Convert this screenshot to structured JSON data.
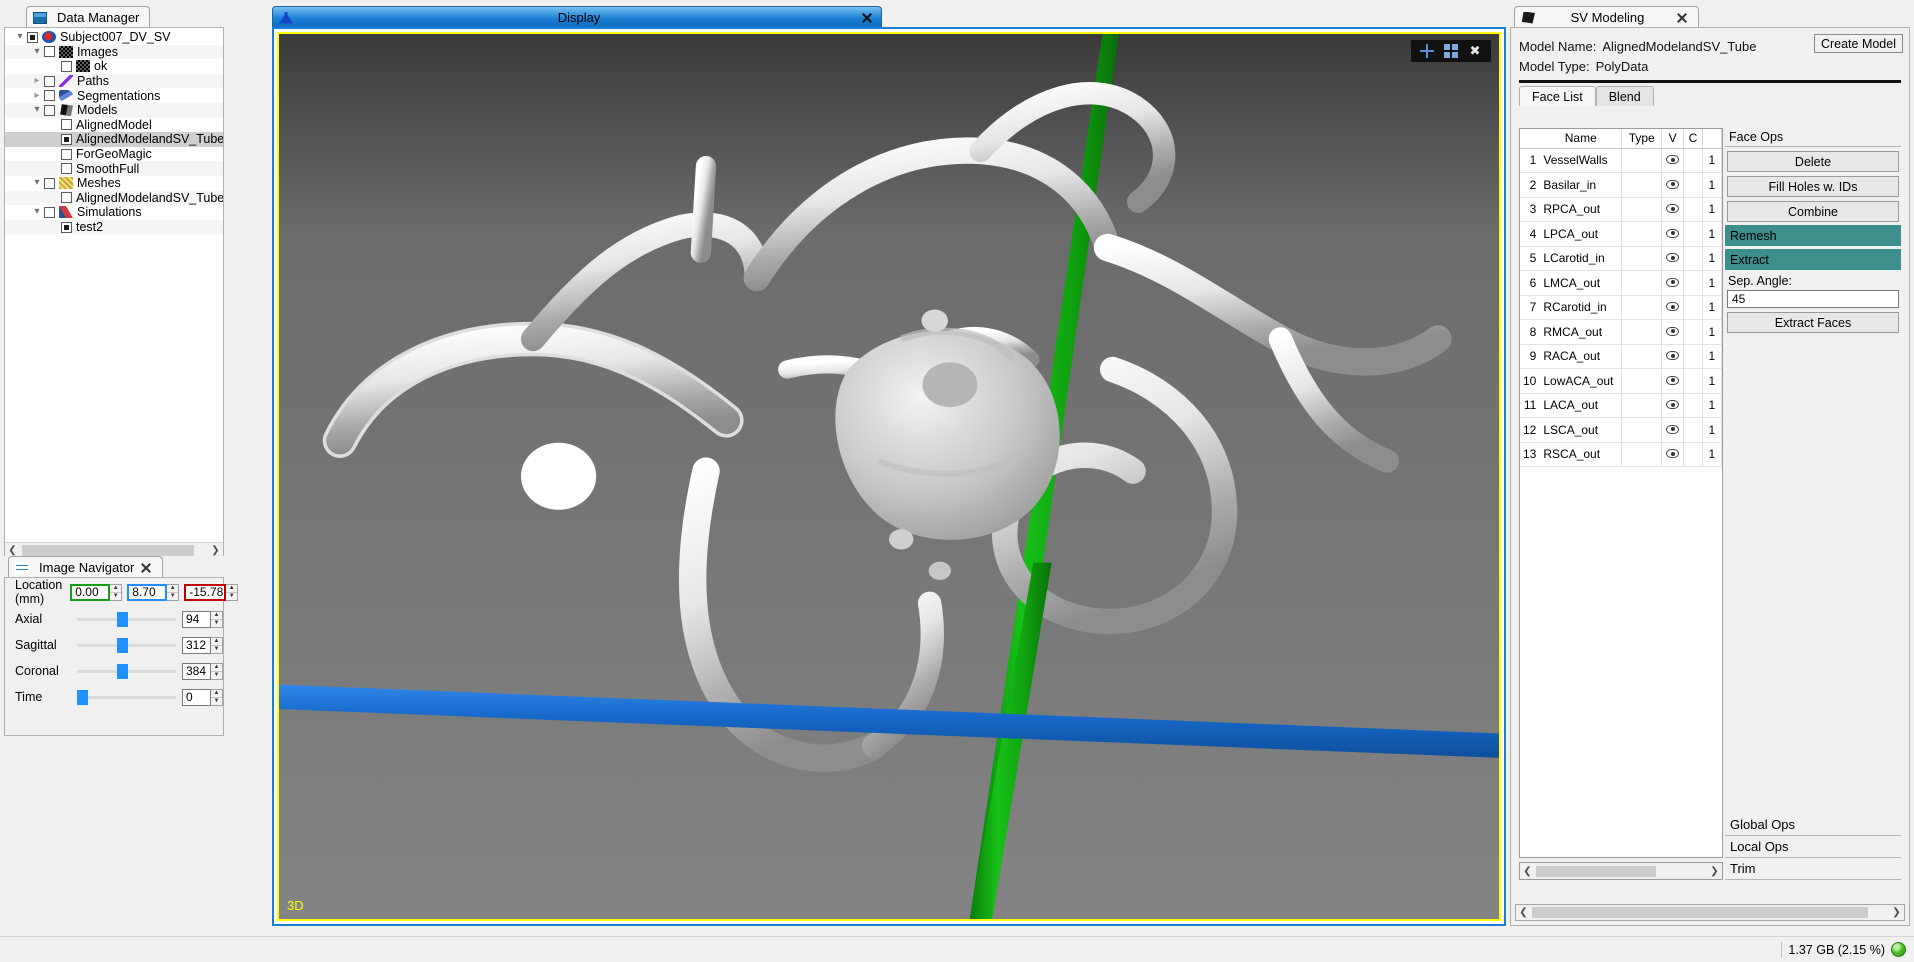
{
  "data_manager": {
    "tab_label": "Data Manager",
    "tab_icon": "data-manager-icon",
    "tree": [
      {
        "label": "Subject007_DV_SV",
        "indent": 0,
        "arrow": "down",
        "checkbox": "filled",
        "icon": "project-icon"
      },
      {
        "label": "Images",
        "indent": 1,
        "arrow": "down",
        "checkbox": "empty",
        "icon": "image-icon"
      },
      {
        "label": "ok",
        "indent": 2,
        "arrow": "none",
        "checkbox": "empty",
        "icon": "image-icon"
      },
      {
        "label": "Paths",
        "indent": 1,
        "arrow": "right",
        "checkbox": "empty",
        "icon": "path-icon"
      },
      {
        "label": "Segmentations",
        "indent": 1,
        "arrow": "right",
        "checkbox": "empty",
        "icon": "segmentation-icon"
      },
      {
        "label": "Models",
        "indent": 1,
        "arrow": "down",
        "checkbox": "empty",
        "icon": "model-icon"
      },
      {
        "label": "AlignedModel",
        "indent": 2,
        "arrow": "none",
        "checkbox": "empty",
        "icon": "none"
      },
      {
        "label": "AlignedModelandSV_Tube",
        "indent": 2,
        "arrow": "none",
        "checkbox": "filled",
        "icon": "none",
        "selected": true
      },
      {
        "label": "ForGeoMagic",
        "indent": 2,
        "arrow": "none",
        "checkbox": "empty",
        "icon": "none"
      },
      {
        "label": "SmoothFull",
        "indent": 2,
        "arrow": "none",
        "checkbox": "empty",
        "icon": "none"
      },
      {
        "label": "Meshes",
        "indent": 1,
        "arrow": "down",
        "checkbox": "empty",
        "icon": "mesh-icon"
      },
      {
        "label": "AlignedModelandSV_Tube",
        "indent": 2,
        "arrow": "none",
        "checkbox": "empty",
        "icon": "none"
      },
      {
        "label": "Simulations",
        "indent": 1,
        "arrow": "down",
        "checkbox": "empty",
        "icon": "simulation-icon"
      },
      {
        "label": "test2",
        "indent": 2,
        "arrow": "none",
        "checkbox": "filled",
        "icon": "none"
      }
    ]
  },
  "image_navigator": {
    "tab_label": "Image Navigator",
    "location_label": "Location (mm)",
    "location": [
      {
        "value": "0.00",
        "color": "#13a013"
      },
      {
        "value": "8.70",
        "color": "#1e90ff"
      },
      {
        "value": "-15.78",
        "color": "#c00000"
      }
    ],
    "sliders": [
      {
        "label": "Axial",
        "value": "94",
        "percent": 46
      },
      {
        "label": "Sagittal",
        "value": "312",
        "percent": 46
      },
      {
        "label": "Coronal",
        "value": "384",
        "percent": 46
      },
      {
        "label": "Time",
        "value": "0",
        "percent": 0
      }
    ]
  },
  "display": {
    "tab_label": "Display",
    "tab_icon": "display-icon",
    "viewport_label": "3D",
    "toolbar_icons": [
      "crosshair-icon",
      "layout-grid-icon",
      "wrench-icon"
    ],
    "border_color": "#ffff00",
    "axis_colors": {
      "vertical": "#00b000",
      "horizontal": "#1a6fd0"
    },
    "background": "#737373"
  },
  "sv_modeling": {
    "tab_label": "SV Modeling",
    "tab_icon": "model-icon",
    "model_name_label": "Model Name:",
    "model_name_value": "AlignedModelandSV_Tube",
    "model_type_label": "Model Type:",
    "model_type_value": "PolyData",
    "create_model_label": "Create Model",
    "subtabs": [
      {
        "label": "Face List",
        "active": true
      },
      {
        "label": "Blend",
        "active": false
      }
    ],
    "face_table": {
      "columns": [
        "",
        "Name",
        "Type",
        "V",
        "C",
        ""
      ],
      "rows": [
        {
          "index": "1",
          "name": "VesselWalls",
          "type": "",
          "v": "eye-icon",
          "c": "",
          "n": "1"
        },
        {
          "index": "2",
          "name": "Basilar_in",
          "type": "",
          "v": "eye-icon",
          "c": "",
          "n": "1"
        },
        {
          "index": "3",
          "name": "RPCA_out",
          "type": "",
          "v": "eye-icon",
          "c": "",
          "n": "1"
        },
        {
          "index": "4",
          "name": "LPCA_out",
          "type": "",
          "v": "eye-icon",
          "c": "",
          "n": "1"
        },
        {
          "index": "5",
          "name": "LCarotid_in",
          "type": "",
          "v": "eye-icon",
          "c": "",
          "n": "1"
        },
        {
          "index": "6",
          "name": "LMCA_out",
          "type": "",
          "v": "eye-icon",
          "c": "",
          "n": "1"
        },
        {
          "index": "7",
          "name": "RCarotid_in",
          "type": "",
          "v": "eye-icon",
          "c": "",
          "n": "1"
        },
        {
          "index": "8",
          "name": "RMCA_out",
          "type": "",
          "v": "eye-icon",
          "c": "",
          "n": "1"
        },
        {
          "index": "9",
          "name": "RACA_out",
          "type": "",
          "v": "eye-icon",
          "c": "",
          "n": "1"
        },
        {
          "index": "10",
          "name": "LowACA_out",
          "type": "",
          "v": "eye-icon",
          "c": "",
          "n": "1"
        },
        {
          "index": "11",
          "name": "LACA_out",
          "type": "",
          "v": "eye-icon",
          "c": "",
          "n": "1"
        },
        {
          "index": "12",
          "name": "LSCA_out",
          "type": "",
          "v": "eye-icon",
          "c": "",
          "n": "1"
        },
        {
          "index": "13",
          "name": "RSCA_out",
          "type": "",
          "v": "eye-icon",
          "c": "",
          "n": "1"
        }
      ]
    },
    "face_ops": {
      "title": "Face Ops",
      "buttons": [
        {
          "label": "Delete",
          "style": "button"
        },
        {
          "label": "Fill Holes w. IDs",
          "style": "button"
        },
        {
          "label": "Combine",
          "style": "button"
        },
        {
          "label": "Remesh",
          "style": "highlight"
        },
        {
          "label": "Extract",
          "style": "highlight"
        }
      ],
      "sep_angle_label": "Sep. Angle:",
      "sep_angle_value": "45",
      "extract_faces_label": "Extract Faces",
      "highlight_color": "#3f8e8e"
    },
    "sections": [
      {
        "label": "Global Ops"
      },
      {
        "label": "Local Ops"
      },
      {
        "label": "Trim"
      }
    ]
  },
  "status_bar": {
    "memory_text": "1.37 GB (2.15 %)",
    "led_color": "#4fc22a"
  }
}
